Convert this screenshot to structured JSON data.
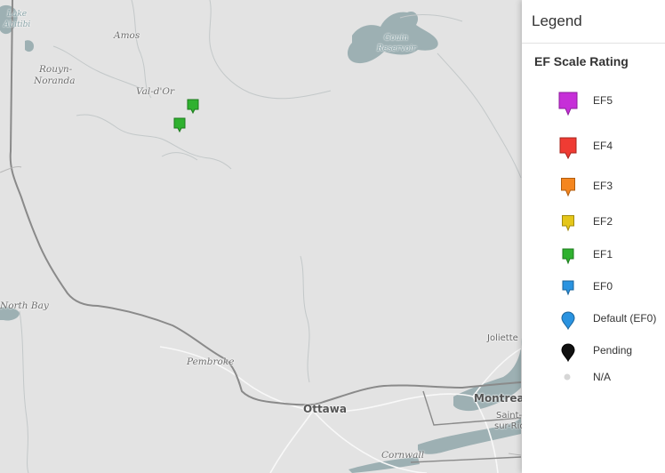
{
  "map": {
    "places": [
      {
        "id": "lake-abitibi-1",
        "text": "Lake",
        "kind": "water"
      },
      {
        "id": "lake-abitibi-2",
        "text": "Abitibi",
        "kind": "water"
      },
      {
        "id": "amos",
        "text": "Amos",
        "kind": "place"
      },
      {
        "id": "rouyn-1",
        "text": "Rouyn-",
        "kind": "place"
      },
      {
        "id": "rouyn-2",
        "text": "Noranda",
        "kind": "place"
      },
      {
        "id": "valdor",
        "text": "Val-d'Or",
        "kind": "place"
      },
      {
        "id": "gouin-1",
        "text": "Gouin",
        "kind": "water"
      },
      {
        "id": "gouin-2",
        "text": "Reservoir",
        "kind": "water"
      },
      {
        "id": "northbay",
        "text": "North Bay",
        "kind": "place"
      },
      {
        "id": "pembroke",
        "text": "Pembroke",
        "kind": "place"
      },
      {
        "id": "ottawa",
        "text": "Ottawa",
        "kind": "city"
      },
      {
        "id": "joliette",
        "text": "Joliette",
        "kind": "town"
      },
      {
        "id": "montreal",
        "text": "Montreal",
        "kind": "city"
      },
      {
        "id": "stjean-1",
        "text": "Saint-J",
        "kind": "town"
      },
      {
        "id": "stjean-2",
        "text": "sur-Ric",
        "kind": "town"
      },
      {
        "id": "cornwall",
        "text": "Cornwall",
        "kind": "place"
      }
    ],
    "markers": [
      {
        "id": "marker-1",
        "rating": "EF1"
      },
      {
        "id": "marker-2",
        "rating": "EF1"
      }
    ]
  },
  "legend": {
    "title": "Legend",
    "subtitle": "EF Scale Rating",
    "items": [
      {
        "label": "EF5",
        "color": "#c62fd8",
        "shape": "pin"
      },
      {
        "label": "EF4",
        "color": "#ef3b33",
        "shape": "pin"
      },
      {
        "label": "EF3",
        "color": "#f5861f",
        "shape": "pin"
      },
      {
        "label": "EF2",
        "color": "#e5c61a",
        "shape": "pin"
      },
      {
        "label": "EF1",
        "color": "#2fb12f",
        "shape": "pin"
      },
      {
        "label": "EF0",
        "color": "#2a93e0",
        "shape": "pin"
      },
      {
        "label": "Default (EF0)",
        "color": "#2a93e0",
        "shape": "drop"
      },
      {
        "label": "Pending",
        "color": "#111111",
        "shape": "drop"
      },
      {
        "label": "N/A",
        "color": "#d6d6d6",
        "shape": "dot"
      }
    ]
  },
  "colors": {
    "land": "#e3e3e3",
    "water": "#9db0b3",
    "border": "#8d8d8d",
    "road": "#ffffff"
  }
}
